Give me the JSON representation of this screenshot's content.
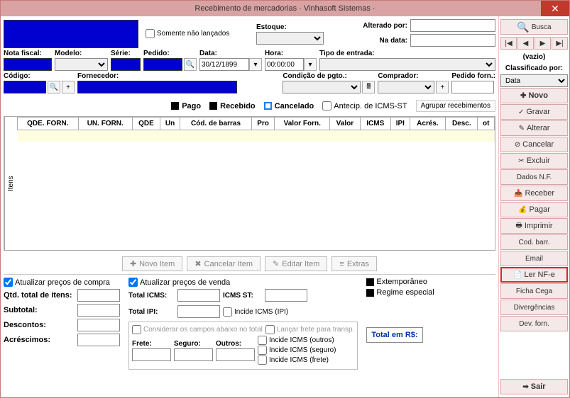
{
  "title": "Recebimento de mercadorias · Vinhasoft Sistemas ·",
  "top": {
    "somente_label": "Somente não lançados",
    "estoque_label": "Estoque:",
    "alterado_label": "Alterado por:",
    "nadata_label": "Na data:"
  },
  "toolbar2": {
    "nf_label": "Nota fiscal:",
    "modelo_label": "Modelo:",
    "serie_label": "Série:",
    "pedido_label": "Pedido:",
    "data_label": "Data:",
    "data_val": "30/12/1899",
    "hora_label": "Hora:",
    "hora_val": "00:00:00",
    "tipo_label": "Tipo de entrada:"
  },
  "toolbar3": {
    "codigo_label": "Código:",
    "forn_label": "Fornecedor:",
    "cond_label": "Condição de pgto.:",
    "comprador_label": "Comprador:",
    "pedforn_label": "Pedido forn.:"
  },
  "status": {
    "pago": "Pago",
    "recebido": "Recebido",
    "cancelado": "Cancelado",
    "antecip": "Antecip. de ICMS-ST",
    "agrupar": "Agrupar recebimentos"
  },
  "grid": {
    "tab": "Itens",
    "cols": [
      "QDE. FORN.",
      "UN. FORN.",
      "QDE",
      "Un",
      "Cód. de barras",
      "Pro",
      "Valor Forn.",
      "Valor",
      "ICMS",
      "IPI",
      "Acrés.",
      "Desc.",
      "ot"
    ]
  },
  "actions": {
    "novo": "Novo Item",
    "cancelar": "Cancelar Item",
    "editar": "Editar Item",
    "extras": "Extras"
  },
  "footer": {
    "atualp_compra": "Atualizar preços de compra",
    "qtd_label": "Qtd. total de itens:",
    "subtotal": "Subtotal:",
    "descontos": "Descontos:",
    "acrescimos": "Acréscimos:",
    "atualp_venda": "Atualizar preços de venda",
    "total_icms": "Total ICMS:",
    "icms_st": "ICMS ST:",
    "total_ipi": "Total IPI:",
    "incide_ipi": "Incide ICMS (IPI)",
    "considerar": "Considerar os campos abaixo no total",
    "lancar_frete": "Lançar frete para transp.",
    "frete": "Frete:",
    "seguro": "Seguro:",
    "outros": "Outros:",
    "incide_outros": "Incide ICMS (outros)",
    "incide_seguro": "Incide ICMS (seguro)",
    "incide_frete": "Incide ICMS (frete)",
    "extemporaneo": "Extemporâneo",
    "regime": "Regime especial",
    "total_rs": "Total em R$:"
  },
  "side": {
    "busca": "Busca",
    "vazio": "(vazio)",
    "classif": "Classificado por:",
    "option": "Data",
    "novo": "Novo",
    "gravar": "Gravar",
    "alterar": "Alterar",
    "cancelar": "Cancelar",
    "excluir": "Excluir",
    "dadosnf": "Dados N.F.",
    "receber": "Receber",
    "pagar": "Pagar",
    "imprimir": "Imprimir",
    "codbarr": "Cod. barr.",
    "email": "Email",
    "lernfe": "Ler NF-e",
    "fichacega": "Ficha Cega",
    "diverg": "Divergências",
    "devforn": "Dev. forn.",
    "sair": "Sair"
  }
}
